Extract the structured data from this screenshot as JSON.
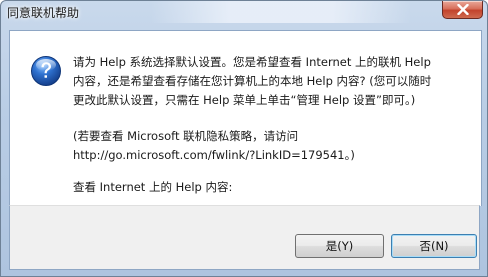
{
  "window": {
    "title": "同意联机帮助"
  },
  "message": {
    "line1": "请为 Help 系统选择默认设置。您是希望查看 Internet 上的联机 Help",
    "line2": "内容，还是希望查看存储在您计算机上的本地 Help 内容? (您可以随时",
    "line3": "更改此默认设置，只需在 Help 菜单上单击“管理 Help 设置”即可。)",
    "privacy_line1": "(若要查看 Microsoft 联机隐私策略，请访问",
    "privacy_line2": "http://go.microsoft.com/fwlink/?LinkID=179541。)",
    "prompt": "查看 Internet 上的 Help 内容:"
  },
  "buttons": {
    "yes": "是(Y)",
    "no": "否(N)"
  },
  "icons": {
    "dialog": "question-icon",
    "close": "close-icon"
  },
  "colors": {
    "close_button": "#c2432c",
    "icon_blue": "#2a5db0",
    "default_button_border": "#3c7fb1"
  }
}
